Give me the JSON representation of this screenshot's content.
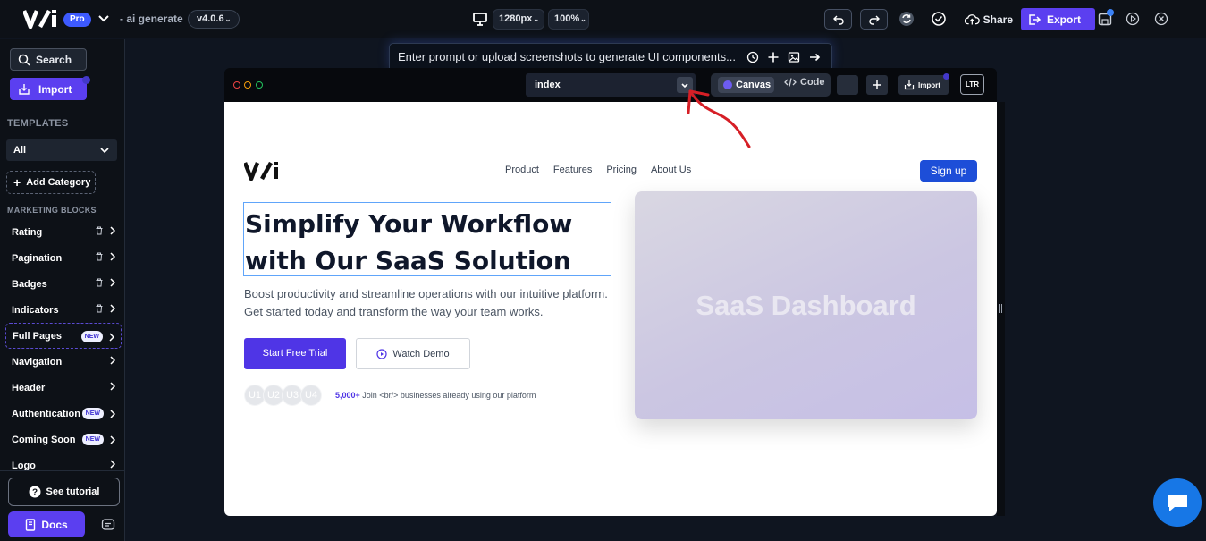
{
  "topbar": {
    "plan_badge": "Pro",
    "project_name": "- ai generate",
    "version": "v4.0.6",
    "width_value": "1280px",
    "zoom_value": "100%",
    "share_label": "Share",
    "export_label": "Export"
  },
  "sidebar": {
    "search_label": "Search",
    "import_label": "Import",
    "templates_heading": "TEMPLATES",
    "filter_value": "All",
    "add_category_label": "Add Category",
    "marketing_heading": "MARKETING BLOCKS",
    "items": [
      {
        "label": "Rating"
      },
      {
        "label": "Pagination"
      },
      {
        "label": "Badges"
      },
      {
        "label": "Indicators"
      },
      {
        "label": "Full Pages",
        "badge": "NEW"
      },
      {
        "label": "Navigation"
      },
      {
        "label": "Header"
      },
      {
        "label": "Authentication",
        "badge": "NEW"
      },
      {
        "label": "Coming Soon",
        "badge": "NEW"
      },
      {
        "label": "Logo"
      }
    ],
    "tutorial_label": "See tutorial",
    "docs_label": "Docs"
  },
  "prompt": {
    "placeholder": "Enter prompt or upload screenshots to generate UI components..."
  },
  "frame": {
    "page_name": "index",
    "canvas_label": "Canvas",
    "code_label": "Code",
    "import_label": "Import",
    "direction_label": "LTR"
  },
  "landing": {
    "nav": [
      "Product",
      "Features",
      "Pricing",
      "About Us"
    ],
    "signup_label": "Sign up",
    "hero_title": "Simplify Your Workflow with Our SaaS Solution",
    "hero_subtitle": "Boost productivity and streamline operations with our intuitive platform. Get started today and transform the way your team works.",
    "cta_primary": "Start Free Trial",
    "cta_secondary": "Watch Demo",
    "avatars": [
      "U1",
      "U2",
      "U3",
      "U4"
    ],
    "social_count": "5,000+",
    "social_text": "Join <br/> businesses already using our platform",
    "image_label": "SaaS Dashboard"
  },
  "colors": {
    "accent": "#5b3ff0",
    "signup": "#1d4ed8",
    "chat": "#1777e6",
    "annotation": "#d61f26"
  }
}
